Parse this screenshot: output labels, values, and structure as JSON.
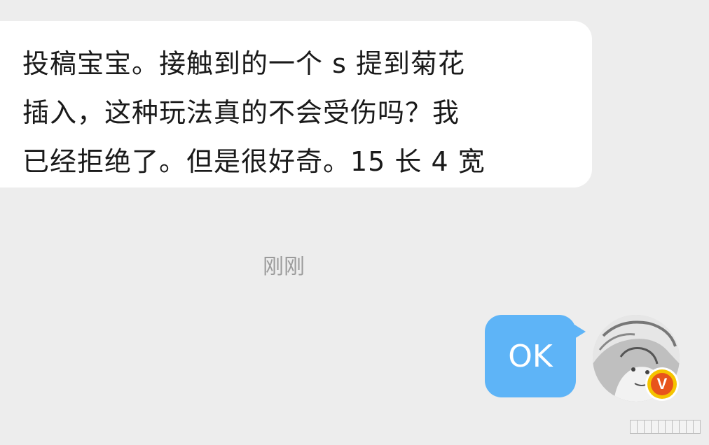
{
  "incoming_message": {
    "line1": "投稿宝宝。接触到的一个 s 提到菊花",
    "line2": "插入，这种玩法真的不会受伤吗？我",
    "line3": "已经拒绝了。但是很好奇。15 长 4 宽"
  },
  "timestamp": "刚刚",
  "outgoing_message": {
    "text": "OK"
  },
  "avatar": {
    "icon": "user-avatar",
    "badge": "V",
    "badge_colors": {
      "ring": "#f5c400",
      "fill": "#e8541c"
    }
  },
  "colors": {
    "background": "#ededed",
    "incoming_bubble": "#ffffff",
    "outgoing_bubble": "#5eb4f7",
    "timestamp_text": "#9b9b9b"
  },
  "watermark": {
    "blocks": 10
  }
}
